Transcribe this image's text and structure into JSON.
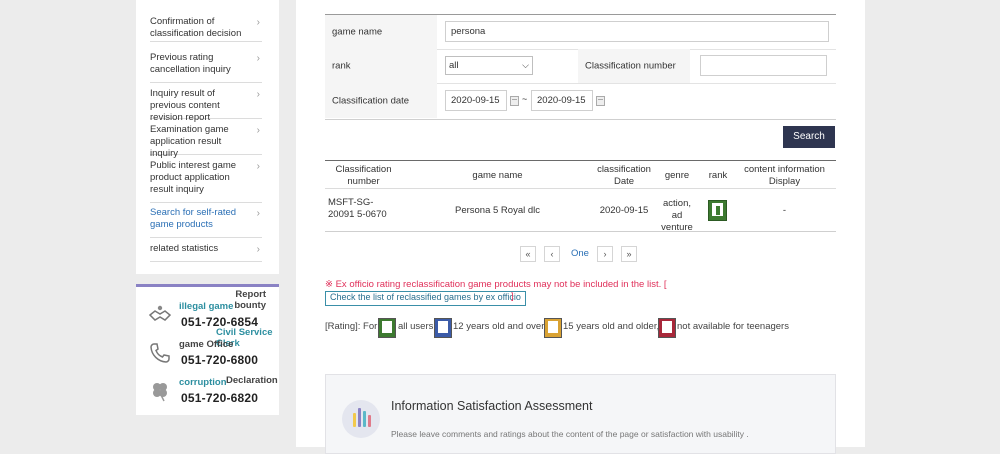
{
  "left_nav": {
    "items": [
      {
        "label": "Confirmation of classification decision",
        "active": false
      },
      {
        "label": "Previous rating cancellation inquiry",
        "active": false
      },
      {
        "label": "Inquiry result of previous content revision report",
        "active": false
      },
      {
        "label": "Examination game application result inquiry",
        "active": false
      },
      {
        "label": "Public interest game product application result inquiry",
        "active": false
      },
      {
        "label": "Search for self-rated game products",
        "active": true
      },
      {
        "label": "related statistics",
        "active": false
      }
    ],
    "chevron": "›"
  },
  "contacts": [
    {
      "icon": "handshake-icon",
      "label": "illegal game",
      "label2": "Report bounty",
      "number": "051-720-6854"
    },
    {
      "icon": "phone-icon",
      "label": "game Office",
      "label2": "Civil Service Clerk",
      "number": "051-720-6800"
    },
    {
      "icon": "clover-icon",
      "label": "corruption",
      "label2": "Declaration",
      "number": "051-720-6820"
    }
  ],
  "search_form": {
    "game_name_label": "game name",
    "game_name_value": "persona",
    "rank_label": "rank",
    "rank_value": "all",
    "classification_number_label": "Classification number",
    "classification_number_value": "",
    "classification_date_label": "Classification date",
    "date_from": "2020-09-15",
    "date_sep": "~",
    "date_to": "2020-09-15",
    "search_button": "Search"
  },
  "results": {
    "headers": [
      "Classification number",
      "game name",
      "classification Date",
      "genre",
      "rank",
      "content information Display"
    ],
    "rows": [
      {
        "classification_number": "MSFT-SG-20091 5-0670",
        "game_name": "Persona 5 Royal dlc",
        "date": "2020-09-15",
        "genre": "action, ad venture",
        "rank": "all users",
        "content_info": "-"
      }
    ]
  },
  "pagination": {
    "first": "«",
    "prev": "‹",
    "current": "One",
    "next": "›",
    "last": "»"
  },
  "notice": {
    "text": "※ Ex officio rating reclassification game products may not be included in the list. [",
    "link": "Check the list of reclassified games by ex officio",
    "close_bracket": "]"
  },
  "rating_legend": {
    "prefix": "[Rating]: For",
    "all": "all users",
    "twelve": "12 years old and over,",
    "fifteen": "15 years old and older,",
    "adult": "not available for teenagers",
    "colors": {
      "all": "#3d7a30",
      "twelve": "#3b5ba8",
      "fifteen": "#d9a233",
      "adult": "#a8283a"
    }
  },
  "assessment": {
    "title": "Information Satisfaction Assessment",
    "subtitle": "Please leave comments and ratings about the content of the page or satisfaction with usability ."
  }
}
